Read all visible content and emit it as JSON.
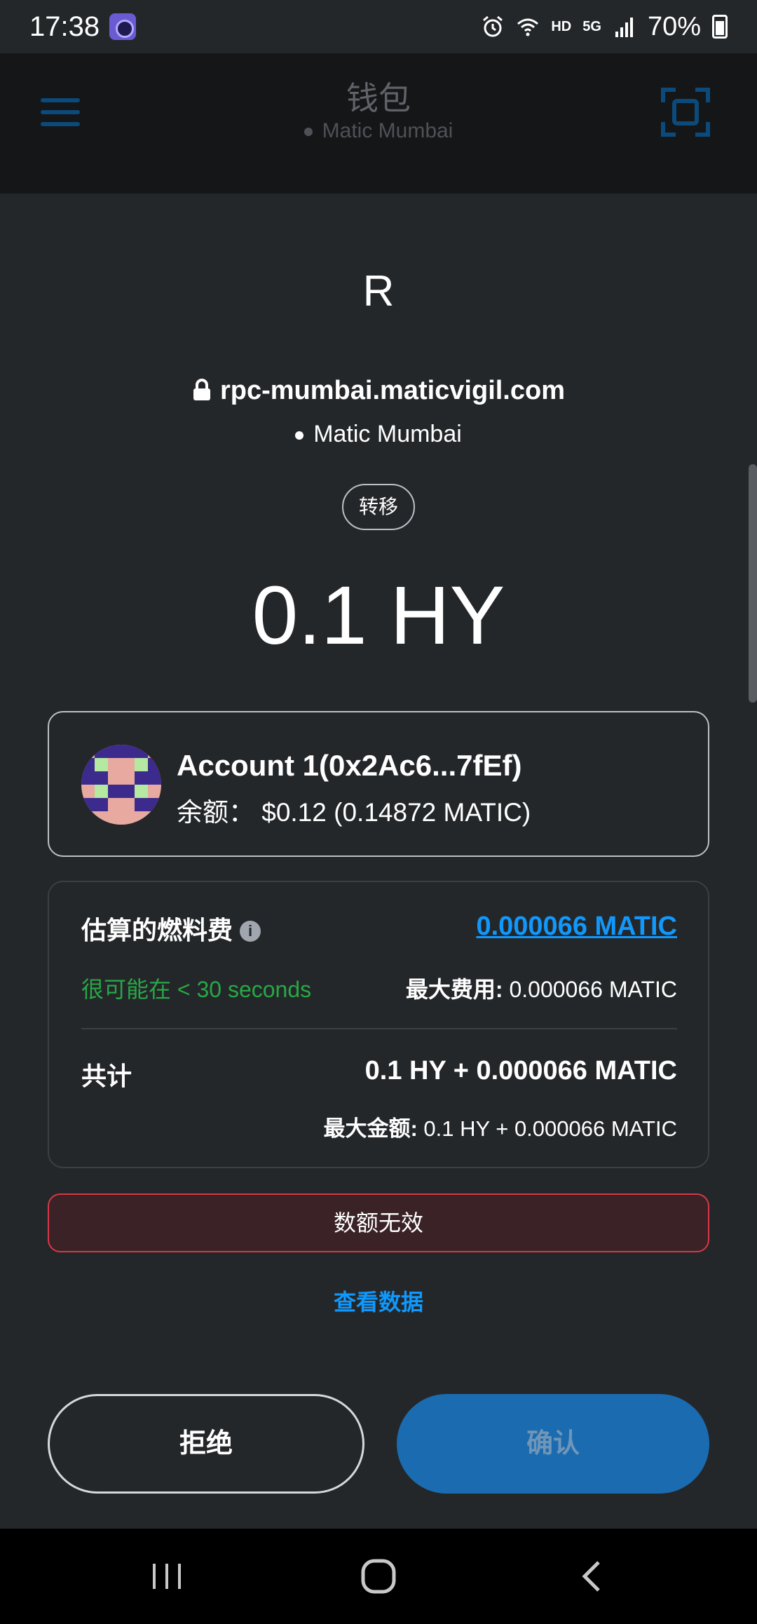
{
  "status_bar": {
    "time": "17:38",
    "hd_label": "HD",
    "network_label": "5G",
    "battery": "70%"
  },
  "app_header": {
    "title": "钱包",
    "network": "Matic Mumbai"
  },
  "request": {
    "dapp_initial": "R",
    "origin": "rpc-mumbai.maticvigil.com",
    "network": "Matic Mumbai",
    "tag": "转移",
    "amount": "0.1 HY"
  },
  "account": {
    "name": "Account 1",
    "address_short": "(0x2Ac6...7fEf)",
    "balance_label": "余额：",
    "balance_value": "$0.12 (0.14872 MATIC)"
  },
  "fees": {
    "estimated_label": "估算的燃料费",
    "estimated_value": "0.000066 MATIC",
    "time_estimate": "很可能在 < 30 seconds",
    "max_fee_label": "最大费用:",
    "max_fee_value": "0.000066 MATIC",
    "total_label": "共计",
    "total_value": "0.1 HY + 0.000066 MATIC",
    "max_amount_label": "最大金额:",
    "max_amount_value": "0.1 HY + 0.000066 MATIC"
  },
  "error": {
    "message": "数额无效"
  },
  "links": {
    "view_data": "查看数据"
  },
  "buttons": {
    "reject": "拒绝",
    "confirm": "确认"
  },
  "colors": {
    "background": "#24272a",
    "link_blue": "#1098fc",
    "success_green": "#28a745",
    "error_red": "#d73847",
    "confirm_blue": "#1b6bb0"
  },
  "icons": {
    "menu": "hamburger-menu-icon",
    "scan": "qr-scan-icon",
    "lock": "lock-icon",
    "info": "info-icon",
    "nav_recent": "recent-apps-icon",
    "nav_home": "home-icon",
    "nav_back": "back-icon"
  }
}
